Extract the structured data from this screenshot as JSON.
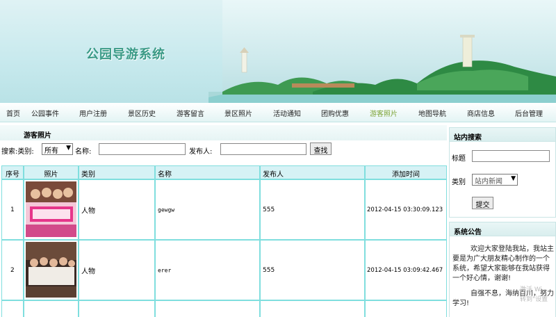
{
  "banner": {
    "title": "公园导游系统"
  },
  "nav": {
    "items": [
      {
        "label": "首页"
      },
      {
        "label": "公园事件"
      },
      {
        "label": "用户注册"
      },
      {
        "label": "景区历史"
      },
      {
        "label": "游客留言"
      },
      {
        "label": "景区照片"
      },
      {
        "label": "活动通知"
      },
      {
        "label": "团购优惠"
      },
      {
        "label": "游客照片"
      },
      {
        "label": "地图导航"
      },
      {
        "label": "商店信息"
      },
      {
        "label": "后台管理"
      }
    ],
    "active_label": "游客照片"
  },
  "main": {
    "section_title": "游客照片",
    "search": {
      "label_prefix": "搜索:类别:",
      "category_value": "所有",
      "name_label": "名称:",
      "name_value": "",
      "poster_label": "发布人:",
      "poster_value": "",
      "button_label": "查找"
    },
    "table": {
      "headers": [
        "序号",
        "照片",
        "类别",
        "名称",
        "发布人",
        "添加时间"
      ],
      "rows": [
        {
          "index": "1",
          "category": "人物",
          "name": "gewgw",
          "poster": "555",
          "time": "2012-04-15 03:30:09.123"
        },
        {
          "index": "2",
          "category": "人物",
          "name": "erer",
          "poster": "555",
          "time": "2012-04-15 03:09:42.467"
        }
      ]
    }
  },
  "sidebar": {
    "search_box": {
      "title": "站内搜索",
      "title_label": "标题",
      "title_value": "",
      "category_label": "类别",
      "category_value": "站内新闻",
      "submit_label": "提交"
    },
    "notice_box": {
      "title": "系统公告",
      "para1": "欢迎大家登陆我站，我站主要是为广大朋友精心制作的一个系统，希望大家能够在我站获得一个好心情，谢谢!",
      "para2": "自强不息，海纳百川，努力学习!"
    }
  },
  "watermark": {
    "line1": "激活 Wi",
    "line2": "转到\"设置"
  },
  "colors": {
    "accent": "#7fdede",
    "header_fill": "#d6f2f5",
    "active_nav": "#7da437",
    "title": "#3a9a86"
  }
}
